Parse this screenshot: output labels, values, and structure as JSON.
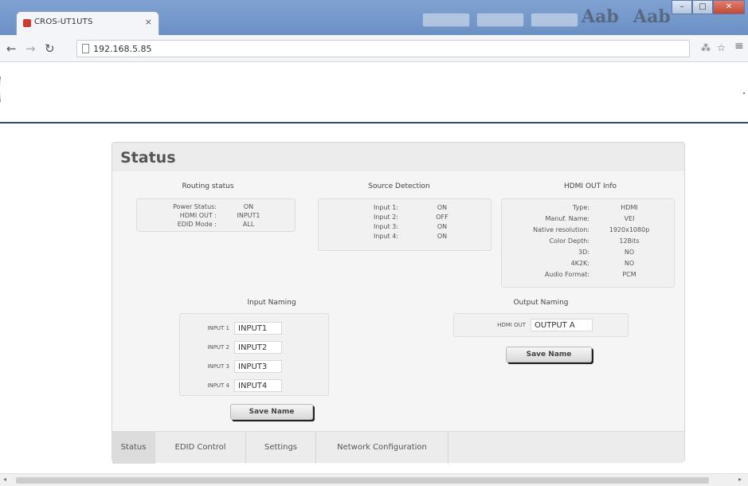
{
  "browser": {
    "tab_title": "CROS-UT1UTS",
    "tab_close": "×",
    "url": "192.168.5.85",
    "ribbon_big_1": "Aab",
    "ribbon_big_2": "Aab"
  },
  "page": {
    "title": "Status",
    "routing": {
      "heading": "Routing status",
      "rows": [
        {
          "label": "Power Status:",
          "value": "ON"
        },
        {
          "label": "HDMI OUT :",
          "value": "INPUT1"
        },
        {
          "label": "EDID Mode :",
          "value": "ALL"
        }
      ]
    },
    "source": {
      "heading": "Source Detection",
      "rows": [
        {
          "label": "Input 1:",
          "value": "ON"
        },
        {
          "label": "Input 2:",
          "value": "OFF"
        },
        {
          "label": "Input 3:",
          "value": "ON"
        },
        {
          "label": "Input 4:",
          "value": "ON"
        }
      ]
    },
    "hdmi_info": {
      "heading": "HDMI OUT Info",
      "rows": [
        {
          "label": "Type:",
          "value": "HDMI"
        },
        {
          "label": "Manuf. Name:",
          "value": "VEI"
        },
        {
          "label": "Native resolution:",
          "value": "1920x1080p"
        },
        {
          "label": "Color Depth:",
          "value": "12Bits"
        },
        {
          "label": "3D:",
          "value": "NO"
        },
        {
          "label": "4K2K:",
          "value": "NO"
        },
        {
          "label": "Audio Format:",
          "value": "PCM"
        }
      ]
    },
    "input_naming": {
      "heading": "Input Naming",
      "rows": [
        {
          "label": "INPUT 1",
          "value": "INPUT1"
        },
        {
          "label": "INPUT 2",
          "value": "INPUT2"
        },
        {
          "label": "INPUT 3",
          "value": "INPUT3"
        },
        {
          "label": "INPUT 4",
          "value": "INPUT4"
        }
      ],
      "save_label": "Save Name"
    },
    "output_naming": {
      "heading": "Output Naming",
      "label": "HDMI OUT",
      "value": "OUTPUT A",
      "save_label": "Save Name"
    },
    "tabs": [
      {
        "label": "Status",
        "active": true
      },
      {
        "label": "EDID Control",
        "active": false
      },
      {
        "label": "Settings",
        "active": false
      },
      {
        "label": "Network Configuration",
        "active": false
      }
    ]
  }
}
